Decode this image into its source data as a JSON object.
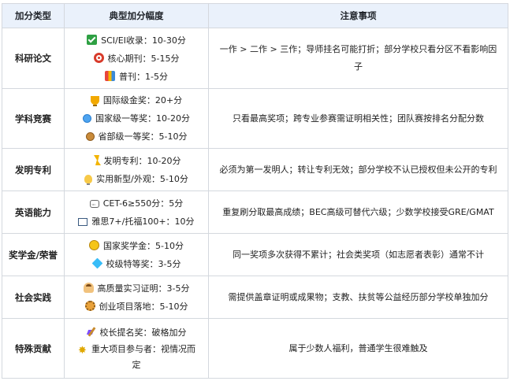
{
  "headers": [
    "加分类型",
    "典型加分幅度",
    "注意事项"
  ],
  "rows": [
    {
      "category": "科研论文",
      "items": [
        {
          "icon": "check-icon",
          "text": "SCI/EI收录：10-30分"
        },
        {
          "icon": "target-icon",
          "text": "核心期刊：5-15分"
        },
        {
          "icon": "book-icon",
          "text": "普刊：1-5分"
        }
      ],
      "note": "一作 > 二作 > 三作；导师挂名可能打折；部分学校只看分区不看影响因子"
    },
    {
      "category": "学科竞赛",
      "items": [
        {
          "icon": "trophy-icon",
          "text": "国际级金奖：20+分"
        },
        {
          "icon": "medal-icon",
          "text": "国家级一等奖：10-20分"
        },
        {
          "icon": "medal-icon",
          "text": "省部级一等奖：5-10分"
        }
      ],
      "note": "只看最高奖项；跨专业参赛需证明相关性；团队赛按排名分配分数"
    },
    {
      "category": "发明专利",
      "items": [
        {
          "icon": "lightning-icon",
          "text": "发明专利：10-20分"
        },
        {
          "icon": "lightbulb-icon",
          "text": "实用新型/外观：5-10分"
        }
      ],
      "note": "必须为第一发明人；转让专利无效；部分学校不认已授权但未公开的专利"
    },
    {
      "category": "英语能力",
      "items": [
        {
          "icon": "chat-bubble-icon",
          "text": "CET-6≥550分：5分"
        },
        {
          "icon": "note-icon",
          "text": "雅思7+/托福100+：10分"
        }
      ],
      "note": "重复刷分取最高成绩；BEC高级可替代六级；少数学校接受GRE/GMAT"
    },
    {
      "category": "奖学金/荣誉",
      "items": [
        {
          "icon": "coin-icon",
          "text": "国家奖学金：5-10分"
        },
        {
          "icon": "diamond-icon",
          "text": "校级特等奖：3-5分"
        }
      ],
      "note": "同一奖项多次获得不累计；社会类奖项（如志愿者表彰）通常不计"
    },
    {
      "category": "社会实践",
      "items": [
        {
          "icon": "person-icon",
          "text": "高质量实习证明：3-5分"
        },
        {
          "icon": "gear-icon",
          "text": "创业项目落地：5-10分"
        }
      ],
      "note": "需提供盖章证明或成果物；支教、扶贫等公益经历部分学校单独加分"
    },
    {
      "category": "特殊贡献",
      "items": [
        {
          "icon": "pen-icon",
          "text": "校长提名奖：破格加分"
        },
        {
          "icon": "star-icon",
          "text": "重大项目参与者：视情况而定"
        }
      ],
      "note": "属于少数人福利，普通学生很难触及"
    }
  ]
}
